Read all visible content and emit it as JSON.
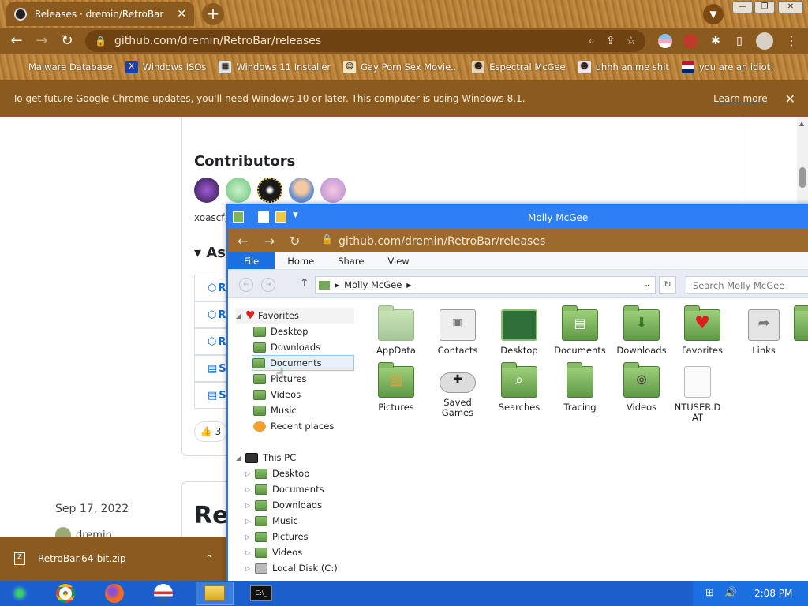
{
  "browser": {
    "tab_title": "Releases · dremin/RetroBar",
    "new_tab_label": "+",
    "url": "github.com/dremin/RetroBar/releases",
    "bookmarks": [
      "Malware Database",
      "Windows ISOs",
      "Windows 11 Installer",
      "Gay Porn Sex Movie...",
      "Espectral McGee",
      "uhhh anime shit",
      "you are an idiot!"
    ],
    "infobar": {
      "message": "To get future Google Chrome updates, you'll need Windows 10 or later. This computer is using Windows 8.1.",
      "link": "Learn more"
    }
  },
  "page": {
    "contributors_title": "Contributors",
    "contributors_names": "xoascf,",
    "assets_title": "As",
    "asset_rows": [
      "R",
      "R",
      "R",
      "S",
      "S"
    ],
    "reaction_count": "3",
    "release_title": "Ret",
    "release_date": "Sep 17, 2022",
    "release_author": "dremin"
  },
  "download": {
    "file_name": "RetroBar.64-bit.zip"
  },
  "explorer": {
    "window_title": "Molly McGee",
    "ghost_url": "github.com/dremin/RetroBar/releases",
    "ribbon_tabs": [
      "File",
      "Home",
      "Share",
      "View"
    ],
    "address_path": "Molly McGee",
    "search_placeholder": "Search Molly McGee",
    "favorites_label": "Favorites",
    "favorites": [
      "Desktop",
      "Downloads",
      "Documents",
      "Pictures",
      "Videos",
      "Music",
      "Recent places"
    ],
    "thispc_label": "This PC",
    "thispc": [
      "Desktop",
      "Documents",
      "Downloads",
      "Music",
      "Pictures",
      "Videos",
      "Local Disk (C:)"
    ],
    "files": [
      "AppData",
      "Contacts",
      "Desktop",
      "Documents",
      "Downloads",
      "Favorites",
      "Links",
      "Pictures",
      "Saved Games",
      "Searches",
      "Tracing",
      "Videos",
      "NTUSER.DAT"
    ]
  },
  "taskbar": {
    "time": "2:08 PM"
  }
}
